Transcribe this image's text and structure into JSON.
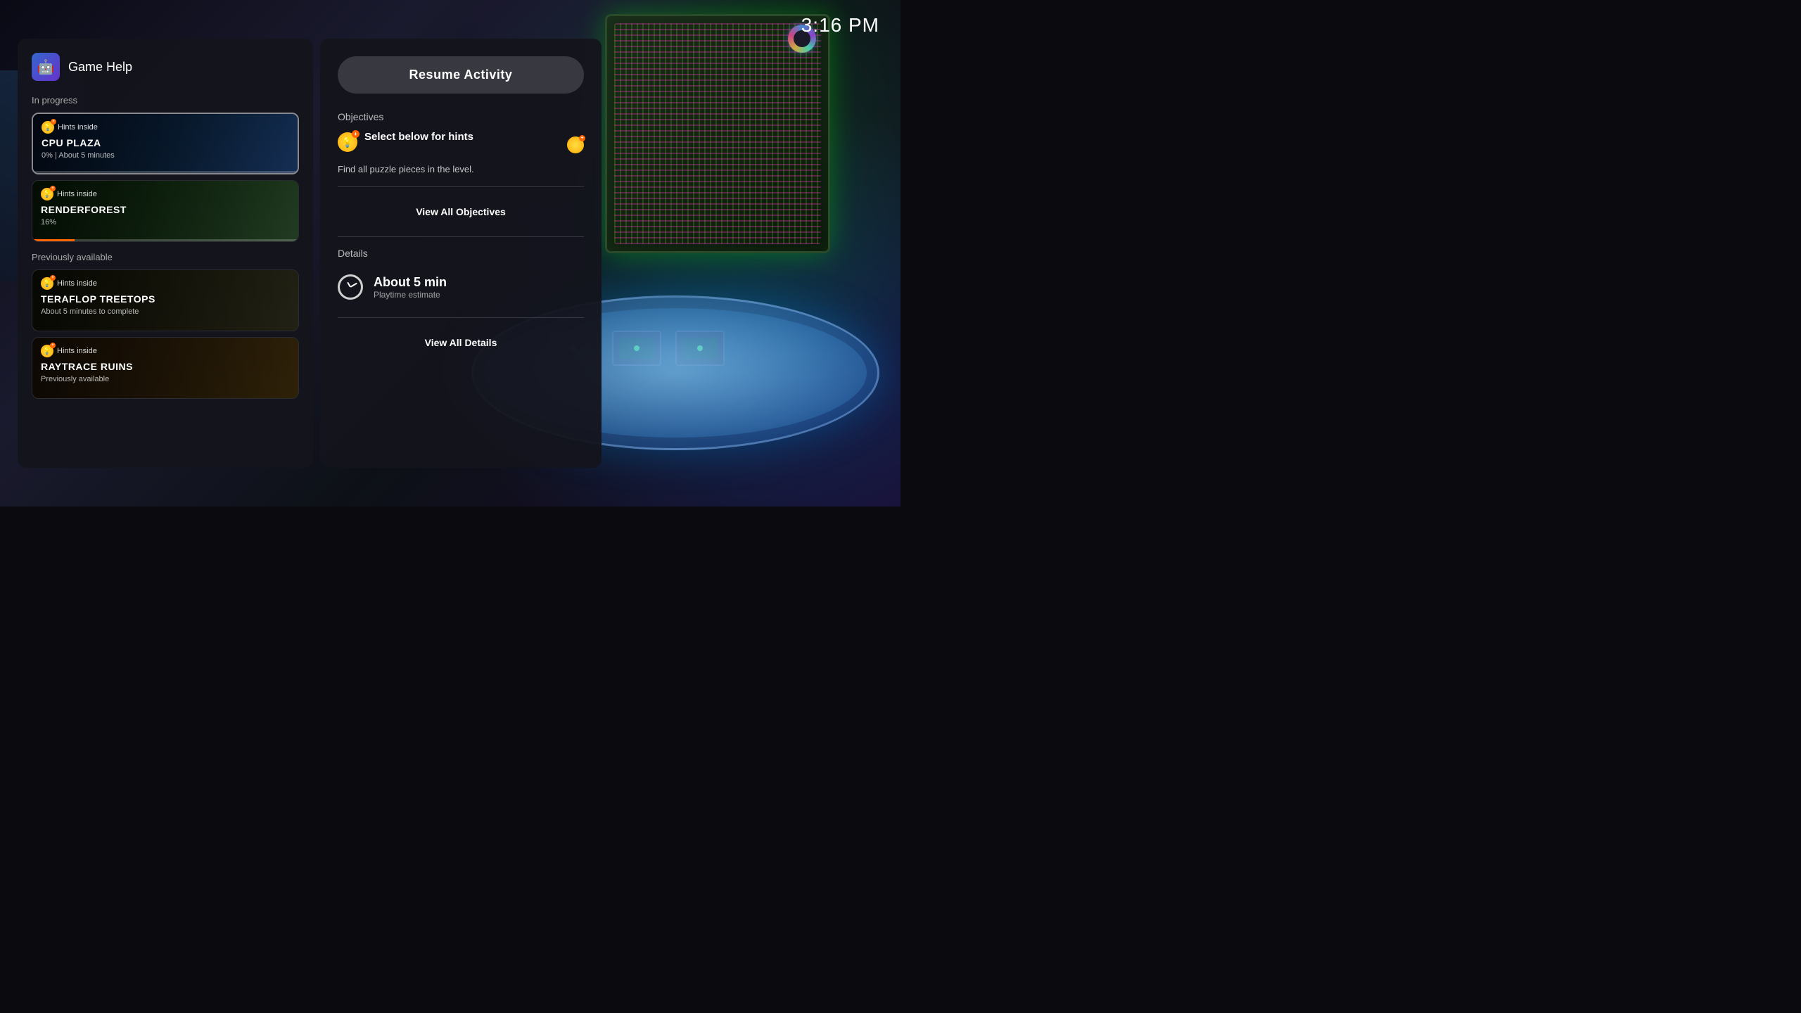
{
  "time": "3:16 PM",
  "panel": {
    "title": "Game Help",
    "icon_emoji": "🤖"
  },
  "in_progress": {
    "label": "In progress",
    "items": [
      {
        "name": "CPU PLAZA",
        "hints_label": "Hints inside",
        "progress_text": "0%  |  About 5 minutes",
        "progress_pct": 0,
        "selected": true,
        "bg_class": "cpu-plaza"
      },
      {
        "name": "RENDERFOREST",
        "hints_label": "Hints inside",
        "progress_text": "16%",
        "progress_pct": 16,
        "selected": false,
        "bg_class": "renderforest"
      }
    ]
  },
  "previously_available": {
    "label": "Previously available",
    "items": [
      {
        "name": "TERAFLOP TREETOPS",
        "hints_label": "Hints inside",
        "progress_text": "About 5 minutes to complete",
        "progress_pct": 0,
        "bg_class": "teraflop"
      },
      {
        "name": "RAYTRACE RUINS",
        "hints_label": "Hints inside",
        "progress_text": "Previously available",
        "progress_pct": 0,
        "bg_class": "raytrace"
      }
    ]
  },
  "right_panel": {
    "resume_button": "Resume Activity",
    "objectives_label": "Objectives",
    "objective_title": "Select below for hints",
    "objective_desc": "Find all puzzle pieces in the level.",
    "view_all_objectives": "View All Objectives",
    "details_label": "Details",
    "playtime_amount": "About 5 min",
    "playtime_label": "Playtime estimate",
    "view_all_details": "View All Details"
  }
}
